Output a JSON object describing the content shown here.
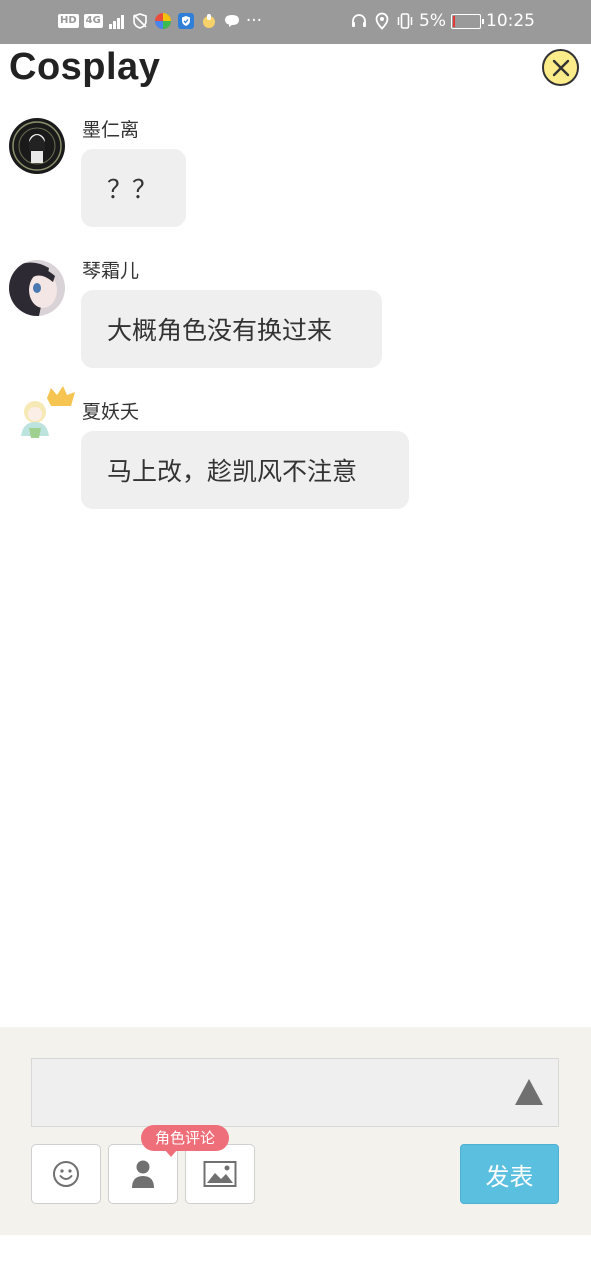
{
  "status_bar": {
    "network_badge": "HD",
    "signal_label": "4G",
    "battery_percent": "5%",
    "time": "10:25",
    "battery_level": 0.05
  },
  "header": {
    "title": "Cosplay",
    "close_icon": "close-circle-icon"
  },
  "messages": [
    {
      "sender": "墨仁离",
      "text": "？？"
    },
    {
      "sender": "琴霜儿",
      "text": "大概角色没有换过来"
    },
    {
      "sender": "夏妖夭",
      "text": "马上改，趁凯风不注意"
    }
  ],
  "composer": {
    "input_value": "",
    "role_comment_tip": "角色评论",
    "submit_label": "发表",
    "icons": [
      "smiley-icon",
      "person-icon",
      "image-icon",
      "send-up-arrow-icon"
    ]
  },
  "colors": {
    "status_bar": "#9a9a9a",
    "close_button": "#fcec8a",
    "bubble": "#efefef",
    "composer_bg": "#f3f2ec",
    "submit": "#5bbfe0",
    "role_tip": "#ee6f7a"
  }
}
